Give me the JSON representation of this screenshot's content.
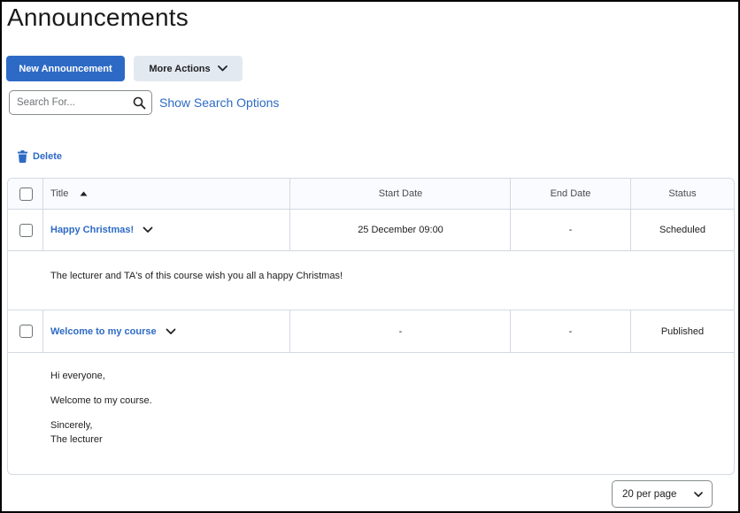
{
  "page": {
    "title": "Announcements"
  },
  "toolbar": {
    "new_label": "New Announcement",
    "more_label": "More Actions"
  },
  "search": {
    "placeholder": "Search For...",
    "options_label": "Show Search Options"
  },
  "bulk": {
    "delete_label": "Delete"
  },
  "table": {
    "columns": {
      "title": "Title",
      "start": "Start Date",
      "end": "End Date",
      "status": "Status"
    },
    "rows": [
      {
        "title": "Happy Christmas!",
        "start": "25 December 09:00",
        "end": "-",
        "status": "Scheduled",
        "body": [
          "The lecturer and TA's of this course wish you all a happy Christmas!"
        ]
      },
      {
        "title": "Welcome to my course",
        "start": "-",
        "end": "-",
        "status": "Published",
        "body": [
          "Hi everyone,",
          "Welcome to my course.",
          "Sincerely,",
          "The lecturer"
        ]
      }
    ]
  },
  "pagination": {
    "per_page_label": "20 per page"
  },
  "colors": {
    "accent": "#2d6ac5",
    "secondary_button": "#e3e9f1",
    "border": "#d3d9e3"
  }
}
